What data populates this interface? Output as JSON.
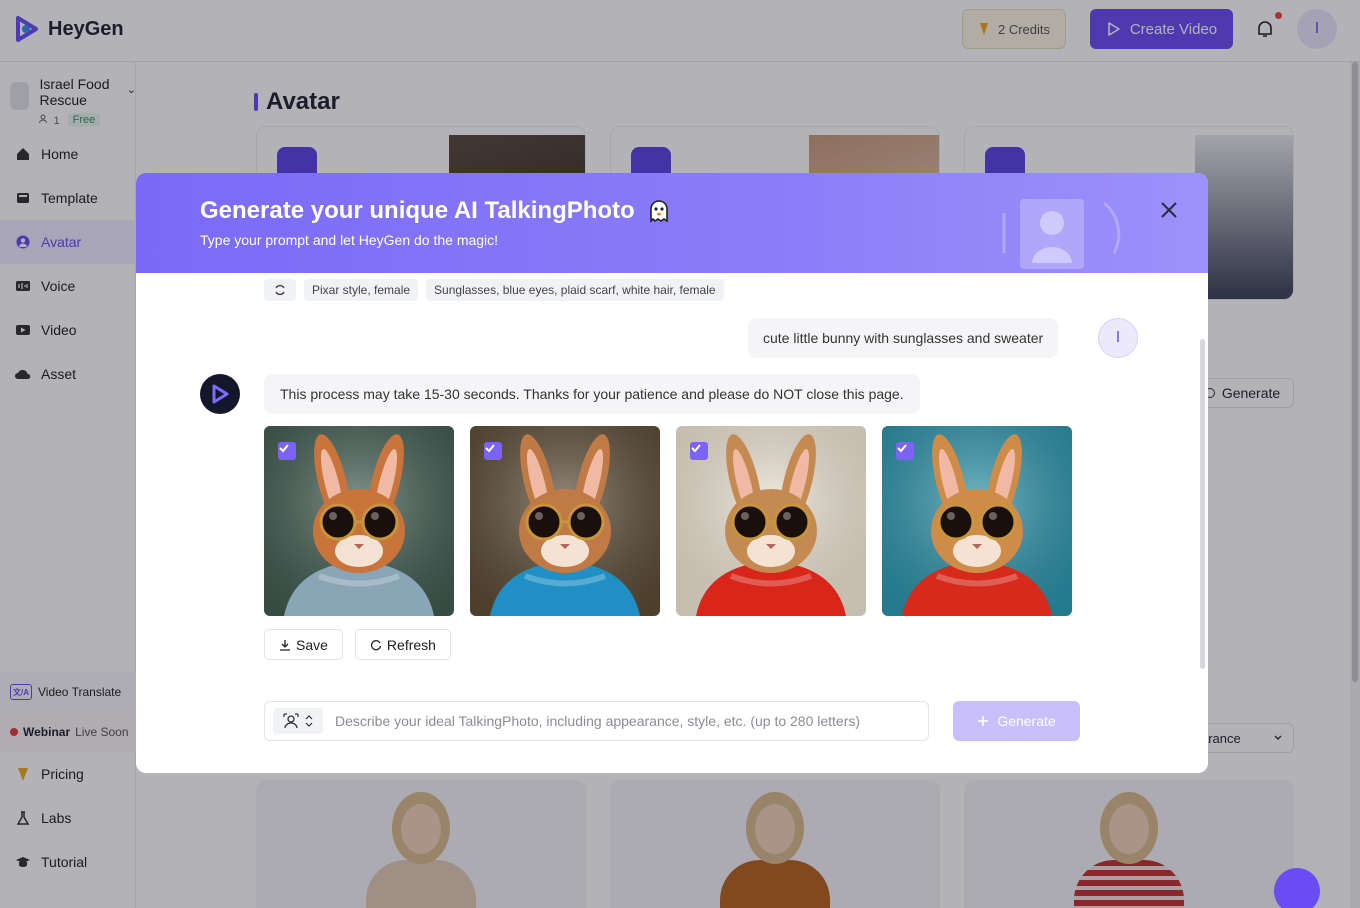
{
  "app": {
    "brand": "HeyGen",
    "credits_label": "2 Credits",
    "create_video_label": "Create Video",
    "user_initial": "I",
    "brand_color": "#6a4cf5"
  },
  "sidebar": {
    "workspace_name": "Israel Food Rescue",
    "member_count": "1",
    "plan": "Free",
    "items": [
      {
        "label": "Home",
        "icon": "home-icon"
      },
      {
        "label": "Template",
        "icon": "template-icon"
      },
      {
        "label": "Avatar",
        "icon": "avatar-icon",
        "active": true
      },
      {
        "label": "Voice",
        "icon": "voice-icon"
      },
      {
        "label": "Video",
        "icon": "video-icon"
      },
      {
        "label": "Asset",
        "icon": "asset-icon"
      }
    ],
    "video_translate_label": "Video Translate",
    "webinar_label": "Webinar",
    "webinar_status": "Live Soon",
    "bottom_items": [
      {
        "label": "Pricing",
        "icon": "pricing-icon"
      },
      {
        "label": "Labs",
        "icon": "labs-icon"
      },
      {
        "label": "Tutorial",
        "icon": "tutorial-icon"
      }
    ]
  },
  "main": {
    "section_title": "Avatar",
    "bg_generate_label": "Generate",
    "bg_select_value": "arance"
  },
  "modal": {
    "title": "Generate your unique AI TalkingPhoto",
    "subtitle": "Type your prompt and let HeyGen do the magic!",
    "suggestions": [
      "Pixar style, female",
      "Sunglasses, blue eyes, plaid scarf, white hair, female"
    ],
    "user_message": "cute little bunny with sunglasses and sweater",
    "bot_message": "This process may take 15-30 seconds. Thanks for your patience and please do NOT close this page.",
    "images": [
      {
        "bg": "#3f5a4f",
        "sweater": "#8aa6b6",
        "fur": "#c9743a",
        "checked": true
      },
      {
        "bg": "#5a4a34",
        "sweater": "#1f8fc4",
        "fur": "#c07a45",
        "checked": true
      },
      {
        "bg": "#e9e0cf",
        "sweater": "#d8261b",
        "fur": "#c58a52",
        "checked": true
      },
      {
        "bg": "#2a8fa6",
        "sweater": "#d62a1c",
        "fur": "#cf8c48",
        "checked": true
      }
    ],
    "save_label": "Save",
    "refresh_label": "Refresh",
    "prompt_placeholder": "Describe your ideal TalkingPhoto, including appearance, style, etc. (up to 280 letters)",
    "generate_label": "Generate"
  }
}
